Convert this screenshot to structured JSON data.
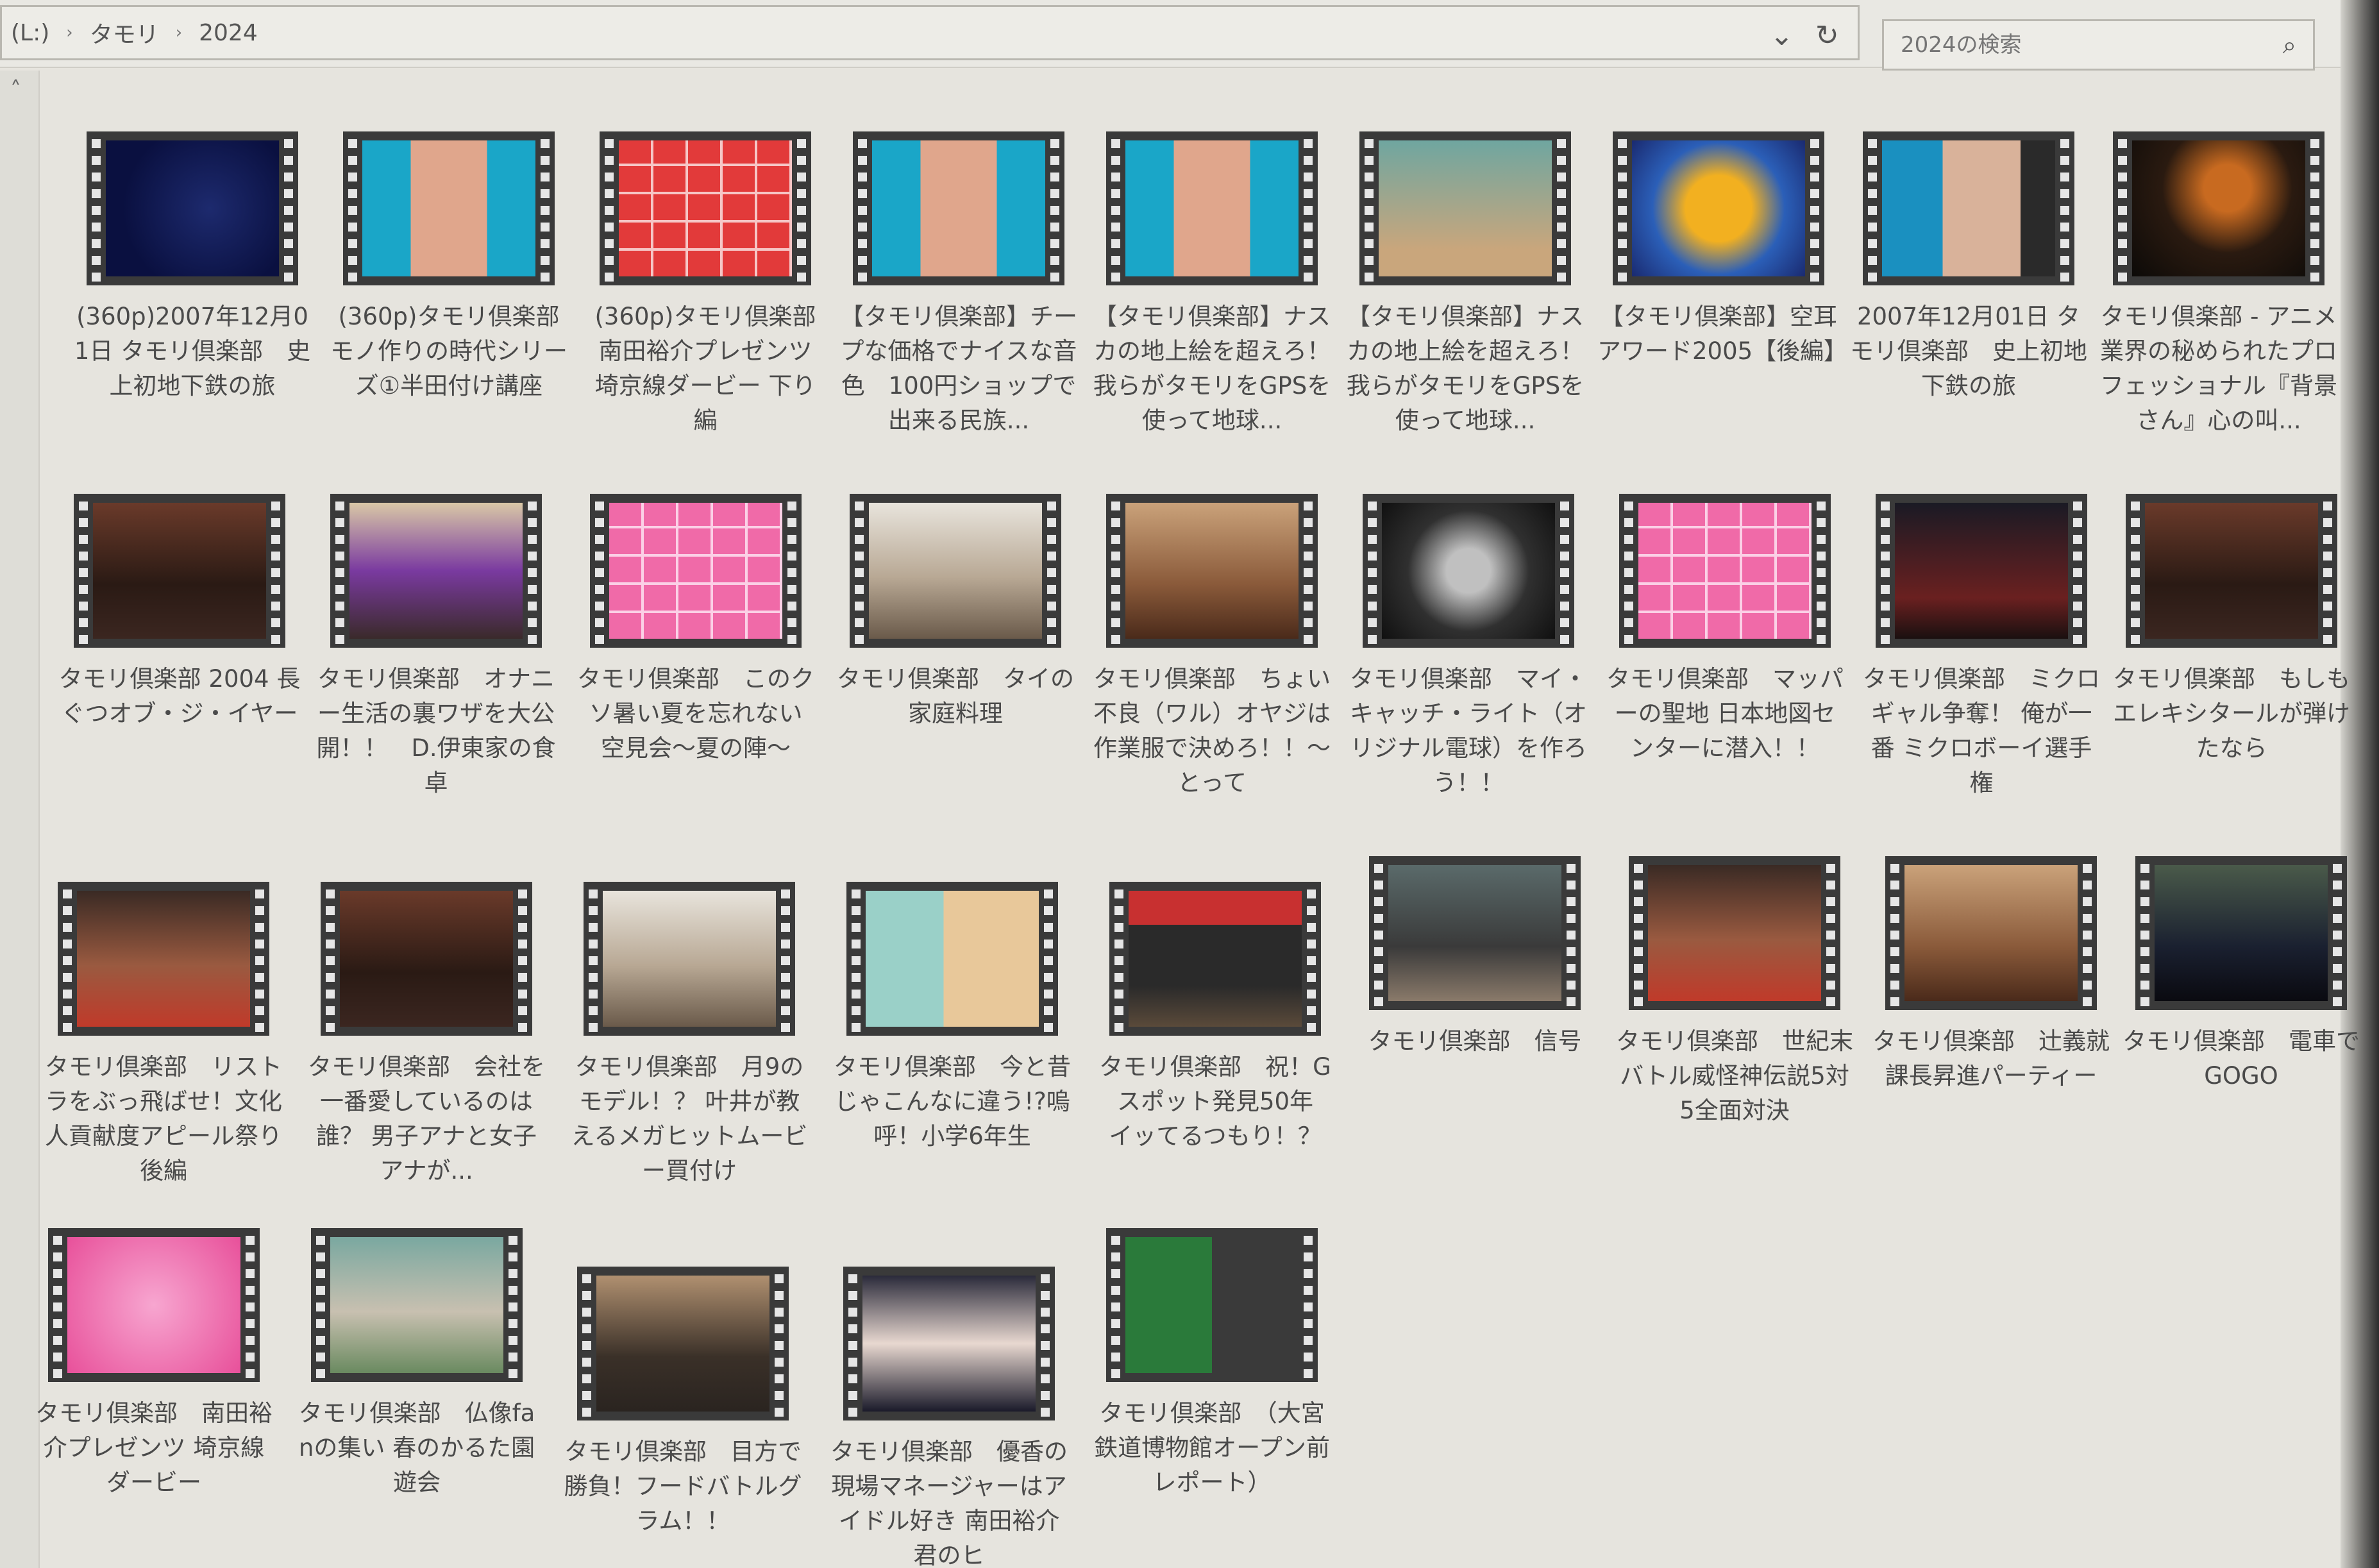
{
  "breadcrumb": [
    "(L:)",
    "タモリ",
    "2024"
  ],
  "search": {
    "placeholder": "2024の検索"
  },
  "icons": {
    "sep": "›",
    "dropdown": "⌄",
    "refresh": "↻",
    "search": "⌕",
    "scroll_up": "˄"
  },
  "files": [
    "(360p)2007年12月01日 タモリ倶楽部　史上初地下鉄の旅",
    "(360p)タモリ倶楽部　モノ作りの時代シリーズ①半田付け講座",
    "(360p)タモリ倶楽部　南田裕介プレゼンツ 埼京線ダービー 下り編",
    "【タモリ倶楽部】チープな価格でナイスな音色　100円ショップで出来る民族...",
    "【タモリ倶楽部】ナスカの地上絵を超えろ！我らがタモリをGPSを使って地球...",
    "【タモリ倶楽部】ナスカの地上絵を超えろ！我らがタモリをGPSを使って地球...",
    "【タモリ倶楽部】空耳アワード2005【後編】",
    "2007年12月01日 タモリ倶楽部　史上初地下鉄の旅",
    "タモリ倶楽部 - アニメ業界の秘められたプロフェッショナル『背景さん』心の叫...",
    "タモリ倶楽部 2004 長ぐつオブ・ジ・イヤー",
    "タモリ倶楽部　オナニー生活の裏ワザを大公開！！　D.伊東家の食卓",
    "タモリ倶楽部　このクソ暑い夏を忘れない 空見会〜夏の陣〜",
    "タモリ倶楽部　タイの家庭料理",
    "タモリ倶楽部　ちょい不良（ワル）オヤジは作業服で決めろ！！〜とって",
    "タモリ倶楽部　マイ・キャッチ・ライト（オリジナル電球）を作ろう！！",
    "タモリ倶楽部　マッパーの聖地 日本地図センターに潜入！！",
    "タモリ倶楽部　ミクロギャル争奪！ 俺が一番 ミクロボーイ選手権",
    "タモリ倶楽部　もしもエレキシタールが弾けたなら",
    "タモリ倶楽部　リストラをぶっ飛ばせ！文化人貢献度アピール祭り 後編",
    "タモリ倶楽部　会社を一番愛しているのは誰？ 男子アナと女子アナが...",
    "タモリ倶楽部　月9のモデル！？ 叶井が教えるメガヒットムービー買付け",
    "タモリ倶楽部　今と昔じゃこんなに違う!?嗚呼！小学6年生",
    "タモリ倶楽部　祝！Gスポット発見50年　イッてるつもり！？",
    "タモリ倶楽部　信号",
    "タモリ倶楽部　世紀末バトル威怪神伝説5対5全面対決",
    "タモリ倶楽部　辻義就課長昇進パーティー",
    "タモリ倶楽部　電車でGOGO",
    "タモリ倶楽部　南田裕介プレゼンツ 埼京線ダービー",
    "タモリ倶楽部　仏像fanの集い 春のかるた園遊会",
    "タモリ倶楽部　目方で勝負！フードバトルグラム！！",
    "タモリ倶楽部　優香の現場マネージャーはアイドル好き 南田裕介君のヒ",
    "タモリ倶楽部　（大宮鉄道博物館オープン前レポート）"
  ]
}
